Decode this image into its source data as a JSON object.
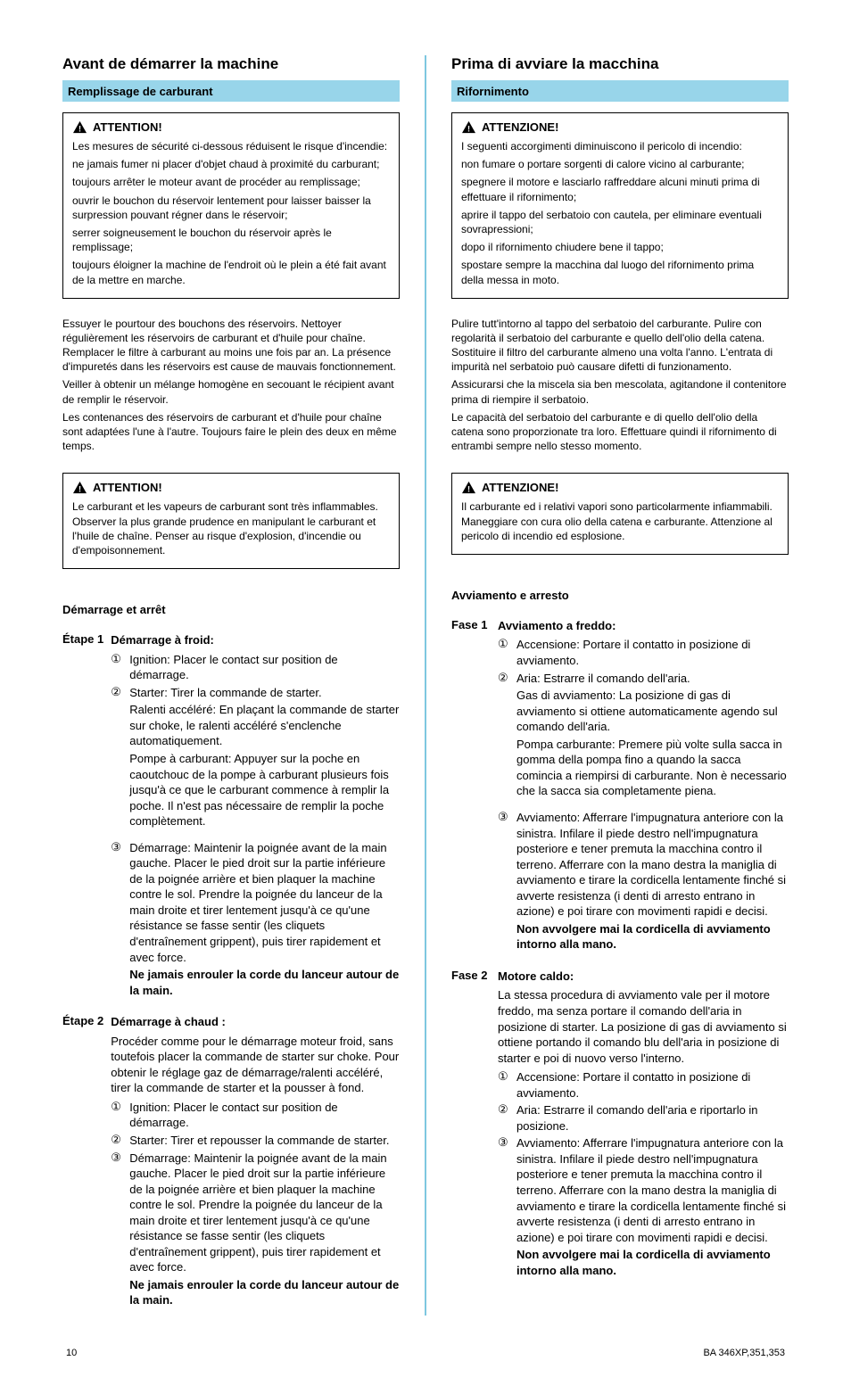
{
  "left": {
    "title": "Avant de démarrer la machine",
    "ribbon": "Remplissage de carburant",
    "caution1": {
      "heading": "ATTENTION!",
      "para": "Les mesures de sécurité ci-dessous réduisent le risque d'incendie:",
      "b1": "ne jamais fumer ni placer d'objet chaud à proximité du carburant;",
      "b2": "toujours arrêter le moteur avant de procéder au remplissage;",
      "b3": "ouvrir le bouchon du réservoir lentement pour laisser baisser la surpression pouvant régner dans le réservoir;",
      "b4": "serrer soigneusement le bouchon du réservoir après le remplissage;",
      "b5": "toujours éloigner la machine de l'endroit où le plein a été fait avant de la mettre en marche."
    },
    "p_wipe": "Essuyer le pourtour des bouchons des réservoirs. Nettoyer régulièrement les réservoirs de carburant et d'huile pour chaîne. Remplacer le filtre à carburant au moins une fois par an. La présence d'impuretés dans les réservoirs est cause de mauvais fonctionnement.",
    "p_shake": "Veiller à obtenir un mélange homogène en secouant le récipient avant de remplir le réservoir.",
    "p_capacity": "Les contenances des réservoirs de carburant et d'huile pour chaîne sont adaptées l'une à l'autre. Toujours faire le plein des deux en même temps.",
    "caution2": {
      "heading": "ATTENTION!",
      "para": "Le carburant et les vapeurs de carburant sont très inflammables. Observer la plus grande prudence en manipulant le carburant et l'huile de chaîne. Penser au risque d'explosion, d'incendie ou d'empoisonnement."
    },
    "subhead_start": "Démarrage et arrêt",
    "step1": {
      "num": "Étape 1",
      "intro": "Démarrage à froid:",
      "e1": "Ignition: Placer le contact sur position de démarrage.",
      "e2_1": "Starter: Tirer la commande de starter.",
      "e2_2": "Ralenti accéléré: En plaçant la commande de starter sur choke, le ralenti accéléré s'enclenche automatiquement.",
      "e2_3": "Pompe à carburant: Appuyer sur la poche en caoutchouc de la pompe à carburant plusieurs fois jusqu'à ce que le carburant commence à remplir la poche. Il n'est pas nécessaire de remplir la poche complètement.",
      "e3_1": "Démarrage: Maintenir la poignée avant de la main gauche. Placer le pied droit sur la partie inférieure de la poignée arrière et bien plaquer la machine contre le sol. Prendre la poignée du lanceur de la main droite et tirer lentement jusqu'à ce qu'une résistance se fasse sentir (les cliquets d'entraînement grippent), puis tirer rapidement et avec force.",
      "e3_2": "Ne jamais enrouler la corde du lanceur autour de la main."
    },
    "step2": {
      "num": "Étape 2",
      "intro": "Démarrage à chaud :",
      "text": "Procéder comme pour le démarrage moteur froid, sans toutefois placer la commande de starter sur choke. Pour obtenir le réglage gaz de démarrage/ralenti accéléré, tirer la commande de starter et la pousser à fond.",
      "e1": "Ignition: Placer le contact sur position de démarrage.",
      "e2": "Starter: Tirer et repousser la commande de starter.",
      "e3_1": "Démarrage: Maintenir la poignée avant de la main gauche. Placer le pied droit sur la partie inférieure de la poignée arrière et bien plaquer la machine contre le sol. Prendre la poignée du lanceur de la main droite et tirer lentement jusqu'à ce qu'une résistance se fasse sentir (les cliquets d'entraînement grippent), puis tirer rapidement et avec force.",
      "e3_2": "Ne jamais enrouler la corde du lanceur autour de la main."
    }
  },
  "right": {
    "title": "Prima di avviare la macchina",
    "ribbon": "Rifornimento",
    "caution1": {
      "heading": "ATTENZIONE!",
      "para": "I seguenti accorgimenti diminuiscono il pericolo di incendio:",
      "b1": "non fumare o portare sorgenti di calore vicino al carburante;",
      "b2": "spegnere il motore e lasciarlo raffreddare alcuni minuti prima di effettuare il rifornimento;",
      "b3": "aprire il tappo del serbatoio con cautela, per eliminare eventuali sovrapressioni;",
      "b4": "dopo il rifornimento chiudere bene il tappo;",
      "b5": "spostare sempre la macchina dal luogo del rifornimento prima della messa in moto."
    },
    "p_wipe": "Pulire tutt'intorno al tappo del serbatoio del carburante. Pulire con regolarità il serbatoio del carburante e quello dell'olio della catena. Sostituire il filtro del carburante almeno una volta l'anno. L'entrata di impurità nel serbatoio può causare difetti di funzionamento.",
    "p_shake": "Assicurarsi che la miscela sia ben mescolata, agitandone il contenitore prima di riempire il serbatoio.",
    "p_capacity": "Le capacità del serbatoio del carburante e di quello dell'olio della catena sono proporzionate tra loro. Effettuare quindi il rifornimento di entrambi sempre nello stesso momento.",
    "caution2": {
      "heading": "ATTENZIONE!",
      "para": "Il carburante ed i relativi vapori sono particolarmente infiammabili. Maneggiare con cura olio della catena e carburante. Attenzione al pericolo di incendio ed esplosione."
    },
    "subhead_start": "Avviamento e arresto",
    "step1": {
      "num": "Fase 1",
      "intro": "Avviamento a freddo:",
      "e1": "Accensione: Portare il contatto in posizione di avviamento.",
      "e2_1": "Aria: Estrarre il comando dell'aria.",
      "e2_2": "Gas di avviamento: La posizione di gas di avviamento si ottiene automaticamente agendo sul comando dell'aria.",
      "e2_3": "Pompa carburante: Premere più volte sulla sacca in gomma della pompa fino a quando la sacca comincia a riempirsi di carburante. Non è necessario che la sacca sia completamente piena.",
      "e3_1": "Avviamento: Afferrare l'impugnatura anteriore con la sinistra. Infilare il piede destro nell'impugnatura posteriore e tener premuta la macchina contro il terreno. Afferrare con la mano destra la maniglia di avviamento e tirare la cordicella lentamente finché si avverte resistenza (i denti di arresto entrano in azione) e poi tirare con movimenti rapidi e decisi.",
      "e3_2": "Non avvolgere mai la cordicella di avviamento intorno alla mano."
    },
    "step2": {
      "num": "Fase 2",
      "intro": "Motore caldo:",
      "text": "La stessa procedura di avviamento vale per il motore freddo, ma senza portare il comando dell'aria in posizione di starter. La posizione di gas di avviamento si ottiene portando il comando blu dell'aria in posizione di starter e poi di nuovo verso l'interno.",
      "e1": "Accensione: Portare il contatto in posizione di avviamento.",
      "e2": "Aria: Estrarre il comando dell'aria e riportarlo in posizione.",
      "e3_1": "Avviamento: Afferrare l'impugnatura anteriore con la sinistra. Infilare il piede destro nell'impugnatura posteriore e tener premuta la macchina contro il terreno. Afferrare con la mano destra la maniglia di avviamento e tirare la cordicella lentamente finché si avverte resistenza (i denti di arresto entrano in azione) e poi tirare con movimenti rapidi e decisi.",
      "e3_2": "Non avvolgere mai la cordicella di avviamento intorno alla mano."
    }
  },
  "footer": {
    "page": "10",
    "doc": "BA 346XP,351,353"
  }
}
